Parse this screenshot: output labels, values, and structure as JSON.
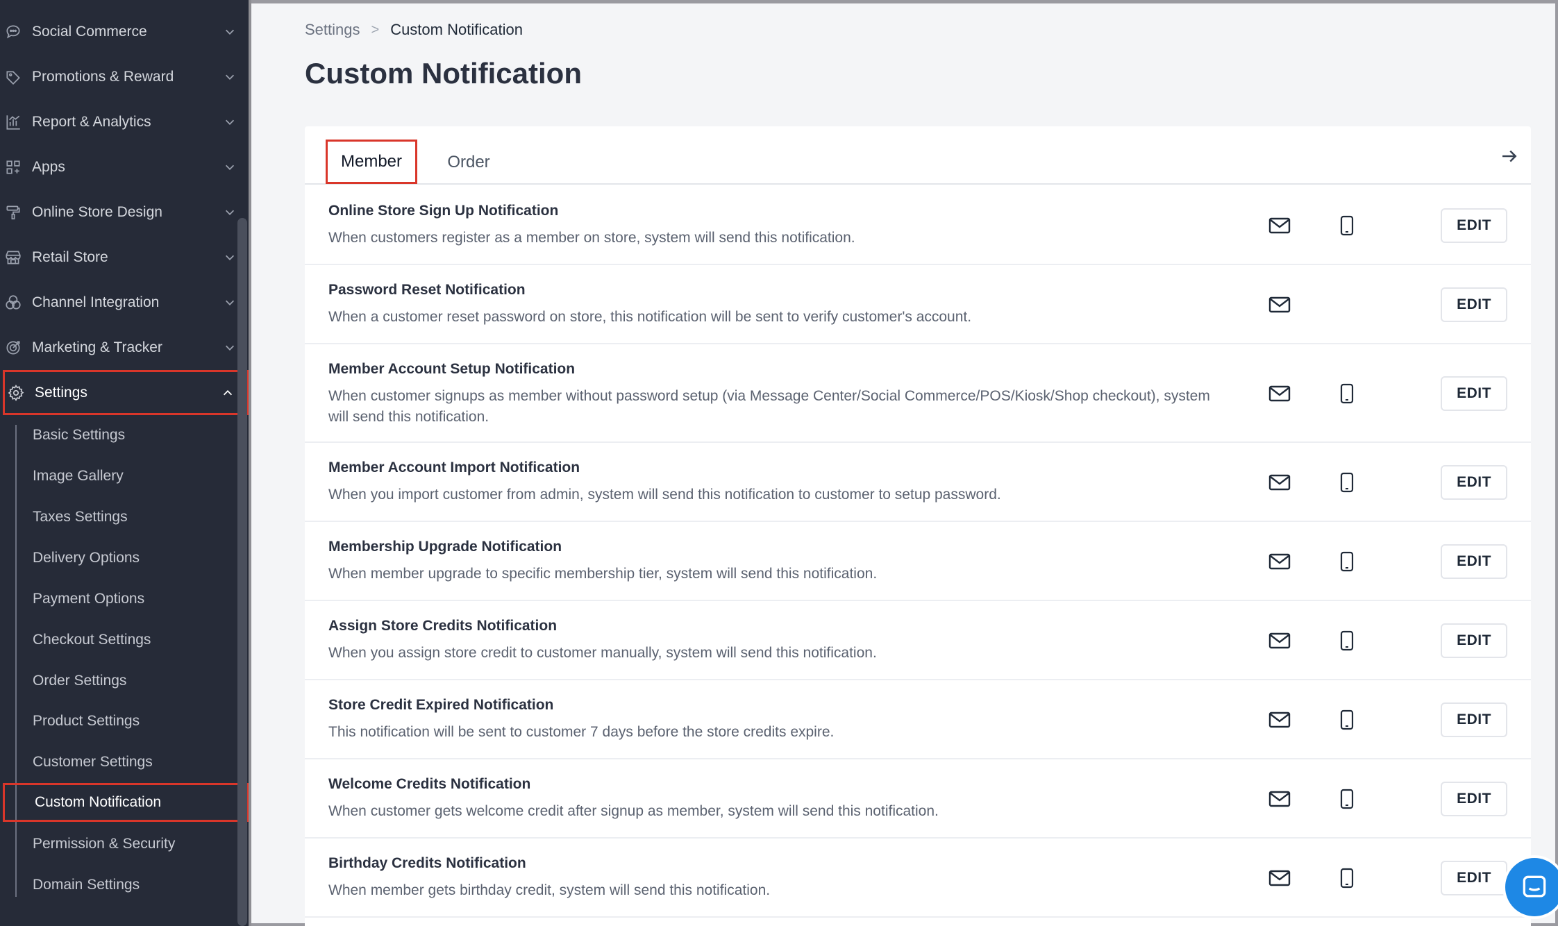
{
  "sidebar": {
    "items": [
      {
        "label": "Social Commerce",
        "icon": "chat-bubble-icon"
      },
      {
        "label": "Promotions & Reward",
        "icon": "tag-icon"
      },
      {
        "label": "Report & Analytics",
        "icon": "bar-chart-icon"
      },
      {
        "label": "Apps",
        "icon": "apps-grid-icon"
      },
      {
        "label": "Online Store Design",
        "icon": "paint-roller-icon"
      },
      {
        "label": "Retail Store",
        "icon": "storefront-icon"
      },
      {
        "label": "Channel Integration",
        "icon": "integration-circles-icon"
      },
      {
        "label": "Marketing & Tracker",
        "icon": "target-icon"
      },
      {
        "label": "Settings",
        "icon": "gear-icon"
      }
    ],
    "settings_sub": [
      {
        "label": "Basic Settings"
      },
      {
        "label": "Image Gallery"
      },
      {
        "label": "Taxes Settings"
      },
      {
        "label": "Delivery Options"
      },
      {
        "label": "Payment Options"
      },
      {
        "label": "Checkout Settings"
      },
      {
        "label": "Order Settings"
      },
      {
        "label": "Product Settings"
      },
      {
        "label": "Customer Settings"
      },
      {
        "label": "Custom Notification"
      },
      {
        "label": "Permission & Security"
      },
      {
        "label": "Domain Settings"
      }
    ]
  },
  "breadcrumb": {
    "parent": "Settings",
    "separator": ">",
    "current": "Custom Notification"
  },
  "page": {
    "title": "Custom Notification"
  },
  "tabs": {
    "member": "Member",
    "order": "Order"
  },
  "rows": [
    {
      "title": "Online Store Sign Up Notification",
      "desc": "When customers register as a member on store, system will send this notification.",
      "phone": true,
      "edit": "EDIT"
    },
    {
      "title": "Password Reset Notification",
      "desc": "When a customer reset password on store, this notification will be sent to verify customer's account.",
      "phone": false,
      "edit": "EDIT"
    },
    {
      "title": "Member Account Setup Notification",
      "desc": "When customer signups as member without password setup (via Message Center/Social Commerce/POS/Kiosk/Shop checkout), system will send this notification.",
      "phone": true,
      "edit": "EDIT"
    },
    {
      "title": "Member Account Import Notification",
      "desc": "When you import customer from admin, system will send this notification to customer to setup password.",
      "phone": true,
      "edit": "EDIT"
    },
    {
      "title": "Membership Upgrade Notification",
      "desc": "When member upgrade to specific membership tier, system will send this notification.",
      "phone": true,
      "edit": "EDIT"
    },
    {
      "title": "Assign Store Credits Notification",
      "desc": "When you assign store credit to customer manually, system will send this notification.",
      "phone": true,
      "edit": "EDIT"
    },
    {
      "title": "Store Credit Expired Notification",
      "desc": "This notification will be sent to customer 7 days before the store credits expire.",
      "phone": true,
      "edit": "EDIT"
    },
    {
      "title": "Welcome Credits Notification",
      "desc": "When customer gets welcome credit after signup as member, system will send this notification.",
      "phone": true,
      "edit": "EDIT"
    },
    {
      "title": "Birthday Credits Notification",
      "desc": "When member gets birthday credit, system will send this notification.",
      "phone": true,
      "edit": "EDIT"
    }
  ],
  "colors": {
    "sidebar_bg": "#262b38",
    "highlight": "#d9362a",
    "chat": "#1e88e5"
  }
}
